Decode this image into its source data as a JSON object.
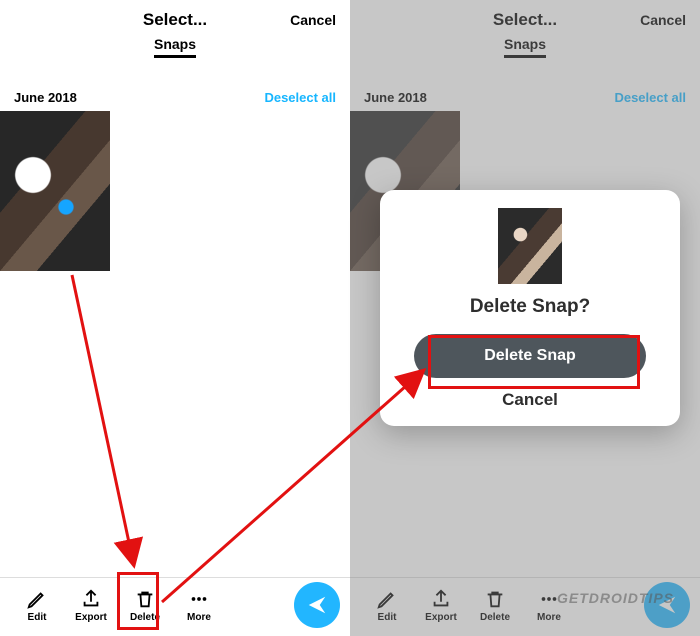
{
  "left": {
    "header": {
      "title": "Select...",
      "cancel": "Cancel"
    },
    "tab": "Snaps",
    "section": {
      "date": "June 2018",
      "deselect": "Deselect all"
    },
    "toolbar": {
      "edit": "Edit",
      "export": "Export",
      "delete": "Delete",
      "more": "More"
    }
  },
  "right": {
    "header": {
      "title": "Select...",
      "cancel": "Cancel"
    },
    "tab": "Snaps",
    "section": {
      "date": "June 2018",
      "deselect": "Deselect all"
    },
    "toolbar": {
      "edit": "Edit",
      "export": "Export",
      "delete": "Delete",
      "more": "More"
    },
    "modal": {
      "title": "Delete Snap?",
      "delete": "Delete Snap",
      "cancel": "Cancel"
    }
  },
  "watermark": "GETDROIDTIPS",
  "colors": {
    "accent": "#22b6ff",
    "highlight": "#e21111",
    "modal_btn": "#4e565c"
  }
}
